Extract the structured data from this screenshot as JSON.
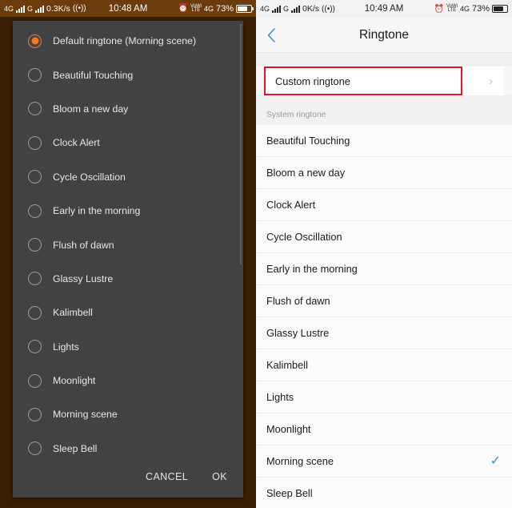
{
  "left": {
    "status_bar": {
      "network_1": "4G",
      "network_2": "G",
      "data_rate": "0.3K/s",
      "cast_icon": "wifi-cast-icon",
      "time": "10:48 AM",
      "alarm_icon": "alarm-clock-icon",
      "volte_top": "VoWi",
      "volte_bottom": "LTE",
      "network_right": "4G",
      "battery_percent": "73%",
      "battery_icon": "battery-icon"
    },
    "dialog": {
      "items": [
        {
          "label": "Default ringtone (Morning scene)",
          "selected": true
        },
        {
          "label": "Beautiful Touching",
          "selected": false
        },
        {
          "label": "Bloom a new day",
          "selected": false
        },
        {
          "label": "Clock Alert",
          "selected": false
        },
        {
          "label": "Cycle Oscillation",
          "selected": false
        },
        {
          "label": "Early in the morning",
          "selected": false
        },
        {
          "label": "Flush of dawn",
          "selected": false
        },
        {
          "label": "Glassy Lustre",
          "selected": false
        },
        {
          "label": "Kalimbell",
          "selected": false
        },
        {
          "label": "Lights",
          "selected": false
        },
        {
          "label": "Moonlight",
          "selected": false
        },
        {
          "label": "Morning scene",
          "selected": false
        },
        {
          "label": "Sleep Bell",
          "selected": false
        }
      ],
      "cancel_label": "CANCEL",
      "ok_label": "OK"
    },
    "colors": {
      "accent": "#f47b20",
      "statusbar": "#6b3b0c",
      "dialog_bg": "#424242"
    }
  },
  "right": {
    "status_bar": {
      "network_1": "4G",
      "network_2": "G",
      "data_rate": "0K/s",
      "cast_icon": "wifi-cast-icon",
      "time": "10:49 AM",
      "alarm_icon": "alarm-clock-icon",
      "volte_top": "VoWi",
      "volte_bottom": "LTE",
      "network_right": "4G",
      "battery_percent": "73%",
      "battery_icon": "battery-icon"
    },
    "header": {
      "back_icon": "chevron-left-icon",
      "title": "Ringtone"
    },
    "custom_row": {
      "label": "Custom ringtone",
      "chevron": "chevron-right-icon",
      "highlighted": true,
      "highlight_color": "#e4122b"
    },
    "section_header": "System ringtone",
    "items": [
      {
        "label": "Beautiful Touching",
        "checked": false
      },
      {
        "label": "Bloom a new day",
        "checked": false
      },
      {
        "label": "Clock Alert",
        "checked": false
      },
      {
        "label": "Cycle Oscillation",
        "checked": false
      },
      {
        "label": "Early in the morning",
        "checked": false
      },
      {
        "label": "Flush of dawn",
        "checked": false
      },
      {
        "label": "Glassy Lustre",
        "checked": false
      },
      {
        "label": "Kalimbell",
        "checked": false
      },
      {
        "label": "Lights",
        "checked": false
      },
      {
        "label": "Moonlight",
        "checked": false
      },
      {
        "label": "Morning scene",
        "checked": true
      },
      {
        "label": "Sleep Bell",
        "checked": false
      }
    ],
    "check_glyph": "✓",
    "colors": {
      "accent": "#3d8fd8",
      "bg": "#f7f7f7"
    }
  }
}
